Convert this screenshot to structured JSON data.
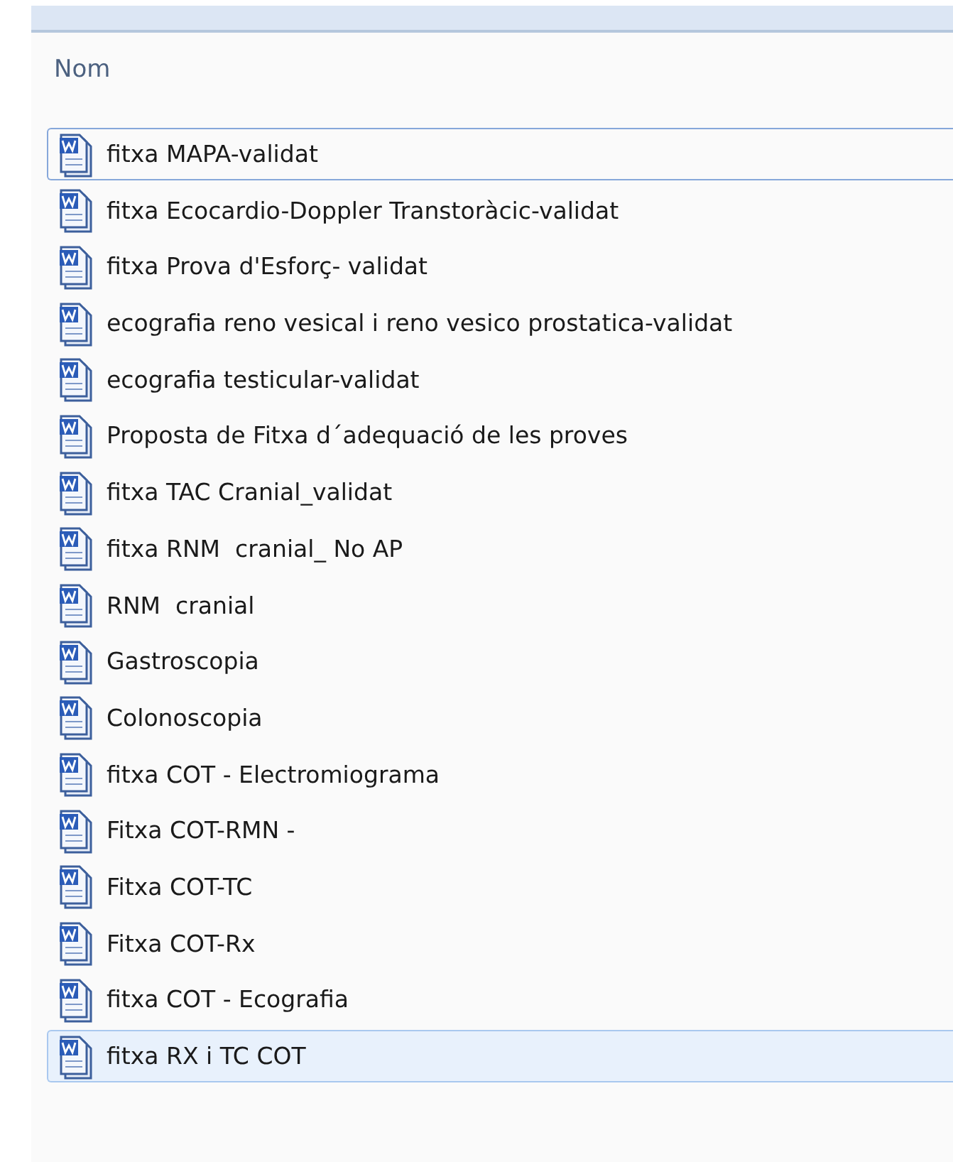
{
  "column_header": "Nom",
  "files": [
    {
      "name": "fitxa MAPA-validat",
      "focused": true,
      "selected": false
    },
    {
      "name": "fitxa Ecocardio-Doppler Transtoràcic-validat",
      "focused": false,
      "selected": false
    },
    {
      "name": "fitxa Prova d'Esforç- validat",
      "focused": false,
      "selected": false
    },
    {
      "name": "ecografia reno vesical i reno vesico prostatica-validat",
      "focused": false,
      "selected": false
    },
    {
      "name": "ecografia testicular-validat",
      "focused": false,
      "selected": false
    },
    {
      "name": "Proposta de Fitxa d´adequació de les proves",
      "focused": false,
      "selected": false
    },
    {
      "name": "fitxa TAC Cranial_validat",
      "focused": false,
      "selected": false
    },
    {
      "name": "fitxa RNM  cranial_ No AP",
      "focused": false,
      "selected": false
    },
    {
      "name": "RNM  cranial",
      "focused": false,
      "selected": false
    },
    {
      "name": "Gastroscopia",
      "focused": false,
      "selected": false
    },
    {
      "name": "Colonoscopia",
      "focused": false,
      "selected": false
    },
    {
      "name": "fitxa COT - Electromiograma",
      "focused": false,
      "selected": false
    },
    {
      "name": "Fitxa COT-RMN -",
      "focused": false,
      "selected": false
    },
    {
      "name": "Fitxa COT-TC",
      "focused": false,
      "selected": false
    },
    {
      "name": "Fitxa COT-Rx",
      "focused": false,
      "selected": false
    },
    {
      "name": "fitxa COT - Ecografia",
      "focused": false,
      "selected": false
    },
    {
      "name": "fitxa RX i TC COT",
      "focused": false,
      "selected": true
    }
  ]
}
